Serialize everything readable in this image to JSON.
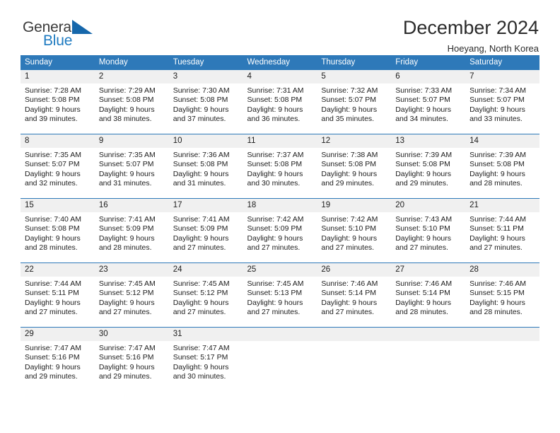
{
  "logo": {
    "word_one": "General",
    "word_two": "Blue",
    "triangle_color": "#1667ab",
    "blue_color": "#1f7bc1"
  },
  "header": {
    "title": "December 2024",
    "subtitle": "Hoeyang, North Korea"
  },
  "theme": {
    "header_blue": "#2e79b9",
    "daynum_gray": "#f0f0f0"
  },
  "weekday_headers": [
    "Sunday",
    "Monday",
    "Tuesday",
    "Wednesday",
    "Thursday",
    "Friday",
    "Saturday"
  ],
  "labels": {
    "sunrise_prefix": "Sunrise:",
    "sunset_prefix": "Sunset:",
    "daylight_prefix": "Daylight:"
  },
  "weeks": [
    [
      {
        "day": "1",
        "line1": "Sunrise: 7:28 AM",
        "line2": "Sunset: 5:08 PM",
        "line3": "Daylight: 9 hours",
        "line4": "and 39 minutes."
      },
      {
        "day": "2",
        "line1": "Sunrise: 7:29 AM",
        "line2": "Sunset: 5:08 PM",
        "line3": "Daylight: 9 hours",
        "line4": "and 38 minutes."
      },
      {
        "day": "3",
        "line1": "Sunrise: 7:30 AM",
        "line2": "Sunset: 5:08 PM",
        "line3": "Daylight: 9 hours",
        "line4": "and 37 minutes."
      },
      {
        "day": "4",
        "line1": "Sunrise: 7:31 AM",
        "line2": "Sunset: 5:08 PM",
        "line3": "Daylight: 9 hours",
        "line4": "and 36 minutes."
      },
      {
        "day": "5",
        "line1": "Sunrise: 7:32 AM",
        "line2": "Sunset: 5:07 PM",
        "line3": "Daylight: 9 hours",
        "line4": "and 35 minutes."
      },
      {
        "day": "6",
        "line1": "Sunrise: 7:33 AM",
        "line2": "Sunset: 5:07 PM",
        "line3": "Daylight: 9 hours",
        "line4": "and 34 minutes."
      },
      {
        "day": "7",
        "line1": "Sunrise: 7:34 AM",
        "line2": "Sunset: 5:07 PM",
        "line3": "Daylight: 9 hours",
        "line4": "and 33 minutes."
      }
    ],
    [
      {
        "day": "8",
        "line1": "Sunrise: 7:35 AM",
        "line2": "Sunset: 5:07 PM",
        "line3": "Daylight: 9 hours",
        "line4": "and 32 minutes."
      },
      {
        "day": "9",
        "line1": "Sunrise: 7:35 AM",
        "line2": "Sunset: 5:07 PM",
        "line3": "Daylight: 9 hours",
        "line4": "and 31 minutes."
      },
      {
        "day": "10",
        "line1": "Sunrise: 7:36 AM",
        "line2": "Sunset: 5:08 PM",
        "line3": "Daylight: 9 hours",
        "line4": "and 31 minutes."
      },
      {
        "day": "11",
        "line1": "Sunrise: 7:37 AM",
        "line2": "Sunset: 5:08 PM",
        "line3": "Daylight: 9 hours",
        "line4": "and 30 minutes."
      },
      {
        "day": "12",
        "line1": "Sunrise: 7:38 AM",
        "line2": "Sunset: 5:08 PM",
        "line3": "Daylight: 9 hours",
        "line4": "and 29 minutes."
      },
      {
        "day": "13",
        "line1": "Sunrise: 7:39 AM",
        "line2": "Sunset: 5:08 PM",
        "line3": "Daylight: 9 hours",
        "line4": "and 29 minutes."
      },
      {
        "day": "14",
        "line1": "Sunrise: 7:39 AM",
        "line2": "Sunset: 5:08 PM",
        "line3": "Daylight: 9 hours",
        "line4": "and 28 minutes."
      }
    ],
    [
      {
        "day": "15",
        "line1": "Sunrise: 7:40 AM",
        "line2": "Sunset: 5:08 PM",
        "line3": "Daylight: 9 hours",
        "line4": "and 28 minutes."
      },
      {
        "day": "16",
        "line1": "Sunrise: 7:41 AM",
        "line2": "Sunset: 5:09 PM",
        "line3": "Daylight: 9 hours",
        "line4": "and 28 minutes."
      },
      {
        "day": "17",
        "line1": "Sunrise: 7:41 AM",
        "line2": "Sunset: 5:09 PM",
        "line3": "Daylight: 9 hours",
        "line4": "and 27 minutes."
      },
      {
        "day": "18",
        "line1": "Sunrise: 7:42 AM",
        "line2": "Sunset: 5:09 PM",
        "line3": "Daylight: 9 hours",
        "line4": "and 27 minutes."
      },
      {
        "day": "19",
        "line1": "Sunrise: 7:42 AM",
        "line2": "Sunset: 5:10 PM",
        "line3": "Daylight: 9 hours",
        "line4": "and 27 minutes."
      },
      {
        "day": "20",
        "line1": "Sunrise: 7:43 AM",
        "line2": "Sunset: 5:10 PM",
        "line3": "Daylight: 9 hours",
        "line4": "and 27 minutes."
      },
      {
        "day": "21",
        "line1": "Sunrise: 7:44 AM",
        "line2": "Sunset: 5:11 PM",
        "line3": "Daylight: 9 hours",
        "line4": "and 27 minutes."
      }
    ],
    [
      {
        "day": "22",
        "line1": "Sunrise: 7:44 AM",
        "line2": "Sunset: 5:11 PM",
        "line3": "Daylight: 9 hours",
        "line4": "and 27 minutes."
      },
      {
        "day": "23",
        "line1": "Sunrise: 7:45 AM",
        "line2": "Sunset: 5:12 PM",
        "line3": "Daylight: 9 hours",
        "line4": "and 27 minutes."
      },
      {
        "day": "24",
        "line1": "Sunrise: 7:45 AM",
        "line2": "Sunset: 5:12 PM",
        "line3": "Daylight: 9 hours",
        "line4": "and 27 minutes."
      },
      {
        "day": "25",
        "line1": "Sunrise: 7:45 AM",
        "line2": "Sunset: 5:13 PM",
        "line3": "Daylight: 9 hours",
        "line4": "and 27 minutes."
      },
      {
        "day": "26",
        "line1": "Sunrise: 7:46 AM",
        "line2": "Sunset: 5:14 PM",
        "line3": "Daylight: 9 hours",
        "line4": "and 27 minutes."
      },
      {
        "day": "27",
        "line1": "Sunrise: 7:46 AM",
        "line2": "Sunset: 5:14 PM",
        "line3": "Daylight: 9 hours",
        "line4": "and 28 minutes."
      },
      {
        "day": "28",
        "line1": "Sunrise: 7:46 AM",
        "line2": "Sunset: 5:15 PM",
        "line3": "Daylight: 9 hours",
        "line4": "and 28 minutes."
      }
    ],
    [
      {
        "day": "29",
        "line1": "Sunrise: 7:47 AM",
        "line2": "Sunset: 5:16 PM",
        "line3": "Daylight: 9 hours",
        "line4": "and 29 minutes."
      },
      {
        "day": "30",
        "line1": "Sunrise: 7:47 AM",
        "line2": "Sunset: 5:16 PM",
        "line3": "Daylight: 9 hours",
        "line4": "and 29 minutes."
      },
      {
        "day": "31",
        "line1": "Sunrise: 7:47 AM",
        "line2": "Sunset: 5:17 PM",
        "line3": "Daylight: 9 hours",
        "line4": "and 30 minutes."
      },
      {
        "day": "",
        "line1": "",
        "line2": "",
        "line3": "",
        "line4": ""
      },
      {
        "day": "",
        "line1": "",
        "line2": "",
        "line3": "",
        "line4": ""
      },
      {
        "day": "",
        "line1": "",
        "line2": "",
        "line3": "",
        "line4": ""
      },
      {
        "day": "",
        "line1": "",
        "line2": "",
        "line3": "",
        "line4": ""
      }
    ]
  ]
}
